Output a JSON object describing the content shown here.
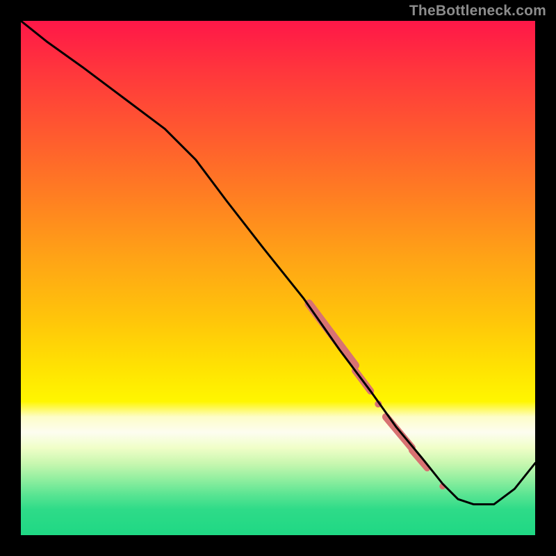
{
  "watermark": "TheBottleneck.com",
  "colors": {
    "bg": "#000000",
    "line": "#000000",
    "marker": "#d87272",
    "white_band": "#fdfdf0",
    "green_band": "#1fd884"
  },
  "chart_data": {
    "type": "line",
    "title": "",
    "xlabel": "",
    "ylabel": "",
    "xlim": [
      0,
      100
    ],
    "ylim": [
      0,
      100
    ],
    "grid": false,
    "legend": false,
    "gradient_stops": [
      {
        "t": 0.0,
        "color": "#ff1748"
      },
      {
        "t": 0.1,
        "color": "#ff373c"
      },
      {
        "t": 0.22,
        "color": "#ff5a2f"
      },
      {
        "t": 0.34,
        "color": "#ff7e22"
      },
      {
        "t": 0.46,
        "color": "#ffa316"
      },
      {
        "t": 0.58,
        "color": "#ffc50a"
      },
      {
        "t": 0.68,
        "color": "#ffe402"
      },
      {
        "t": 0.74,
        "color": "#fff600"
      },
      {
        "t": 0.77,
        "color": "#fdfdc8"
      },
      {
        "t": 0.8,
        "color": "#fdfdf0"
      },
      {
        "t": 0.83,
        "color": "#f0fec8"
      },
      {
        "t": 0.86,
        "color": "#c9f7b0"
      },
      {
        "t": 0.89,
        "color": "#93efa0"
      },
      {
        "t": 0.92,
        "color": "#5ce593"
      },
      {
        "t": 0.95,
        "color": "#2edb88"
      },
      {
        "t": 1.0,
        "color": "#1fd884"
      }
    ],
    "series": [
      {
        "name": "curve",
        "x": [
          0,
          5,
          12,
          20,
          28,
          34,
          40,
          47,
          55,
          62,
          68,
          73,
          78,
          82,
          85,
          88,
          92,
          96,
          100
        ],
        "y": [
          100,
          96,
          91,
          85,
          79,
          73,
          65,
          56,
          46,
          36,
          28,
          21,
          15,
          10,
          7,
          6,
          6,
          9,
          14
        ]
      }
    ],
    "markers": [
      {
        "name": "thick-a",
        "shape": "segment",
        "x0": 56,
        "y0": 45,
        "x1": 65,
        "y1": 33,
        "w": 12
      },
      {
        "name": "thick-b",
        "shape": "segment",
        "x0": 65,
        "y0": 32,
        "x1": 68,
        "y1": 28,
        "w": 10
      },
      {
        "name": "dot-mid",
        "shape": "dot",
        "x": 69.5,
        "y": 25.5,
        "r": 5
      },
      {
        "name": "thick-c",
        "shape": "segment",
        "x0": 71,
        "y0": 23,
        "x1": 76,
        "y1": 17,
        "w": 11
      },
      {
        "name": "thick-d",
        "shape": "segment",
        "x0": 76,
        "y0": 16.5,
        "x1": 79,
        "y1": 13,
        "w": 9
      },
      {
        "name": "dot-low",
        "shape": "dot",
        "x": 82,
        "y": 9.5,
        "r": 4.5
      }
    ]
  }
}
